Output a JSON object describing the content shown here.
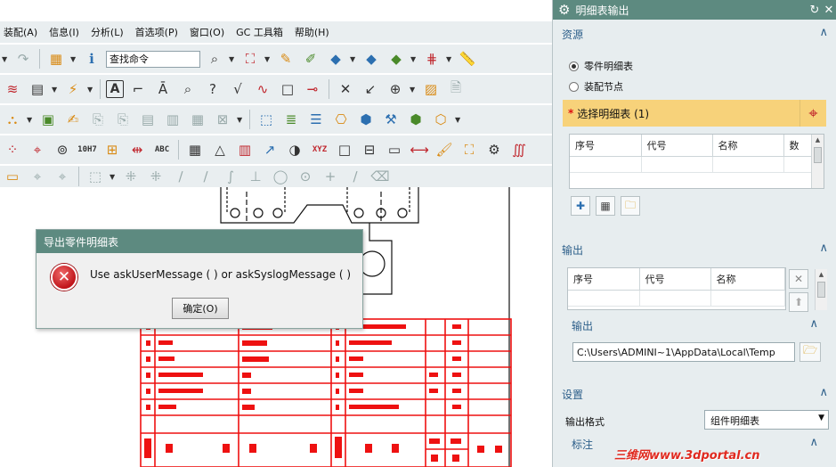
{
  "menubar": {
    "items": [
      "装配(A)",
      "信息(I)",
      "分析(L)",
      "首选项(P)",
      "窗口(O)",
      "GC 工具箱",
      "帮助(H)"
    ]
  },
  "toolbar": {
    "command_search_value": "查找命令",
    "text_icons": {
      "abc": "ABC",
      "fit": "10H7",
      "xyz": "XYZ"
    }
  },
  "dialog": {
    "title": "导出零件明细表",
    "message": "Use askUserMessage ( ) or askSyslogMessage ( )",
    "ok_label": "确定(O)",
    "icon_glyph": "✕"
  },
  "panel": {
    "title": "明细表输出",
    "source": {
      "heading": "资源",
      "radio_part": "零件明细表",
      "radio_assembly": "装配节点",
      "selected": "零件明细表",
      "select_label": "选择明细表 (1)",
      "columns": [
        "序号",
        "代号",
        "名称",
        "数"
      ]
    },
    "output": {
      "heading": "输出",
      "columns": [
        "序号",
        "代号",
        "名称"
      ],
      "sub_heading": "输出",
      "path": "C:\\Users\\ADMINI~1\\AppData\\Local\\Temp"
    },
    "settings": {
      "heading": "设置",
      "format_label": "输出格式",
      "format_value": "组件明细表",
      "annotation_heading": "标注"
    }
  },
  "watermark": "三维网www.3dportal.cn",
  "colors": {
    "panel_header": "#5d8a80",
    "accent_blue": "#2d5f8a",
    "select_bar": "#f7d27a",
    "drawing_red": "#ee1111"
  }
}
